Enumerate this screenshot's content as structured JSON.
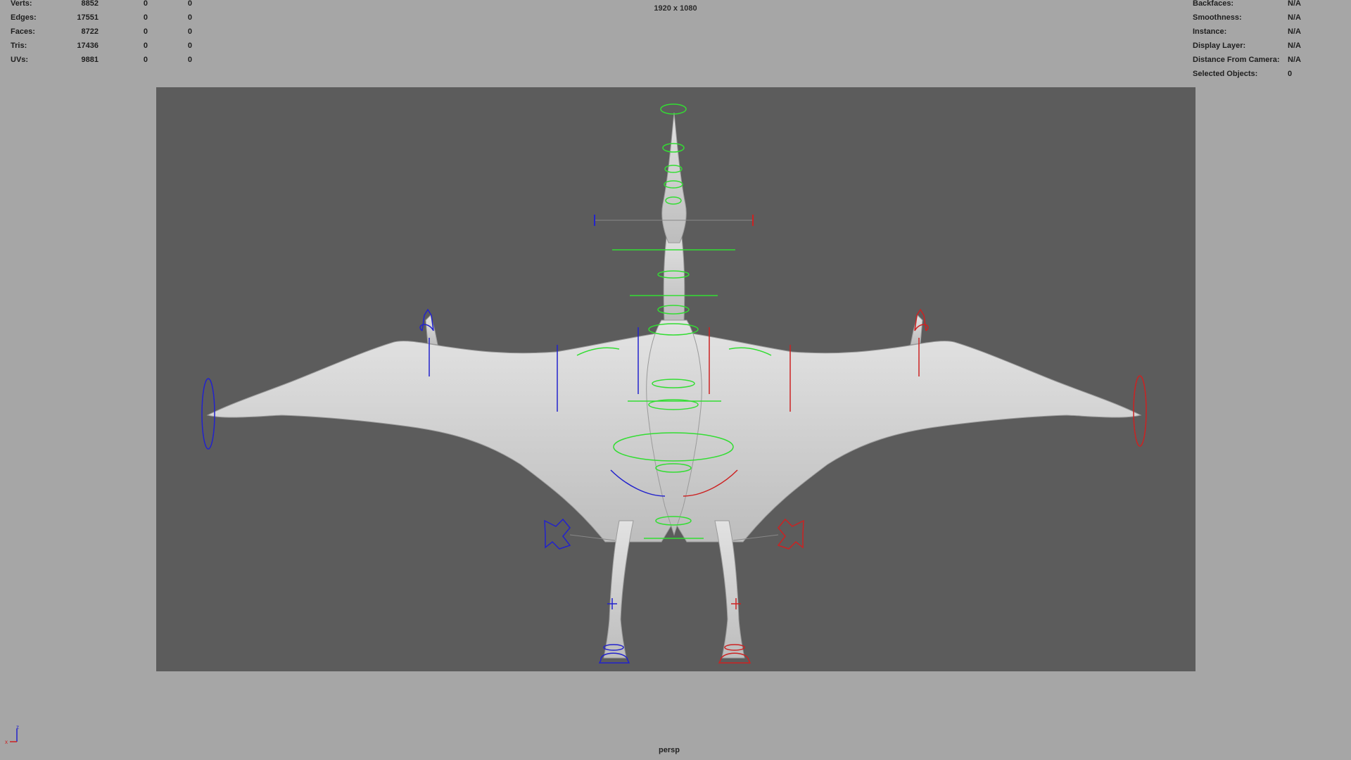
{
  "hud": {
    "poly_count": [
      {
        "label": "Verts:",
        "values": [
          "8852",
          "0",
          "0"
        ]
      },
      {
        "label": "Edges:",
        "values": [
          "17551",
          "0",
          "0"
        ]
      },
      {
        "label": "Faces:",
        "values": [
          "8722",
          "0",
          "0"
        ]
      },
      {
        "label": "Tris:",
        "values": [
          "17436",
          "0",
          "0"
        ]
      },
      {
        "label": "UVs:",
        "values": [
          "9881",
          "0",
          "0"
        ]
      }
    ],
    "object_details": [
      {
        "label": "Backfaces:",
        "value": "N/A"
      },
      {
        "label": "Smoothness:",
        "value": "N/A"
      },
      {
        "label": "Instance:",
        "value": "N/A"
      },
      {
        "label": "Display Layer:",
        "value": "N/A"
      },
      {
        "label": "Distance From Camera:",
        "value": "N/A"
      },
      {
        "label": "Selected Objects:",
        "value": "0"
      }
    ],
    "resolution": "1920 x 1080",
    "camera": "persp"
  },
  "axis_gizmo": {
    "up_label": "z",
    "right_label": "x"
  },
  "colors": {
    "viewport_bg": "#a6a6a6",
    "resolution_gate": "#5c5c5c",
    "mesh": "#d2d2d2",
    "center_controls": "#33dd33",
    "left_controls": "#2222cc",
    "right_controls": "#cc2222"
  }
}
